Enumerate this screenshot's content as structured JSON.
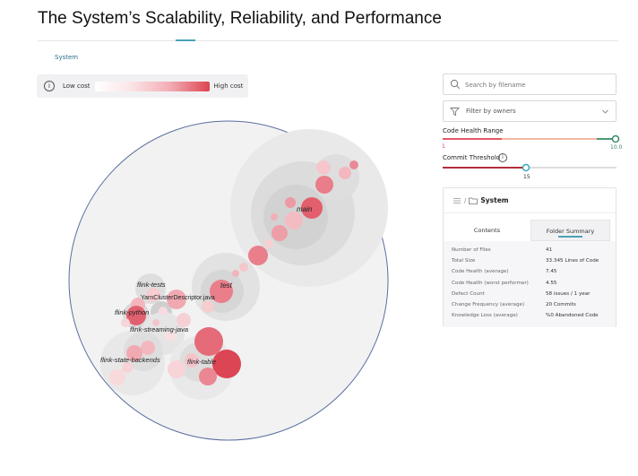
{
  "slide_title": "The System’s Scalability, Reliability, and Performance",
  "nav": {
    "active_tab": "System"
  },
  "legend": {
    "info_icon": "i",
    "low_label": "Low cost",
    "high_label": "High cost"
  },
  "map": {
    "labels": {
      "main": "main",
      "test": "test",
      "flink_tests": "flink-tests",
      "yarn_file": "YarnClusterDescriptor.java",
      "flink_python": "flink-python",
      "flink_streaming_java": "flink-streaming-java",
      "flink_state_backends": "flink-state-backends",
      "flink_table": "flink-table"
    },
    "colors": {
      "low": "#ffffff",
      "mid": "#f2aeb5",
      "high": "#dd4452",
      "circle_bg": "#f2f2f2",
      "outline": "#5b6fa0"
    }
  },
  "search": {
    "placeholder": "Search by filename",
    "icon": "search-icon"
  },
  "owner_filter": {
    "label": "Filter by owners",
    "icon": "filter-icon",
    "chevron": "chevron-down-icon"
  },
  "code_health_range": {
    "label": "Code Health Range",
    "min": "1",
    "max": "10.0"
  },
  "commit_threshold": {
    "label": "Commit Threshold",
    "value": "15",
    "info_icon": "i"
  },
  "summary": {
    "breadcrumb_sep": "/",
    "title": "System",
    "tabs": {
      "contents": "Contents",
      "folder_summary": "Folder Summary"
    },
    "rows": [
      {
        "k": "Number of Files",
        "v": "41"
      },
      {
        "k": "Total Size",
        "v": "33.345 Lines of Code"
      },
      {
        "k": "Code Health (average)",
        "v": "7.45"
      },
      {
        "k": "Code Health (worst performer)",
        "v": "4.55"
      },
      {
        "k": "Defect Count",
        "v": "58 issues / 1 year"
      },
      {
        "k": "Change Frequency (average)",
        "v": "20 Commits"
      },
      {
        "k": "Knowledge Loss (average)",
        "v": "%0 Abandoned Code"
      }
    ]
  }
}
